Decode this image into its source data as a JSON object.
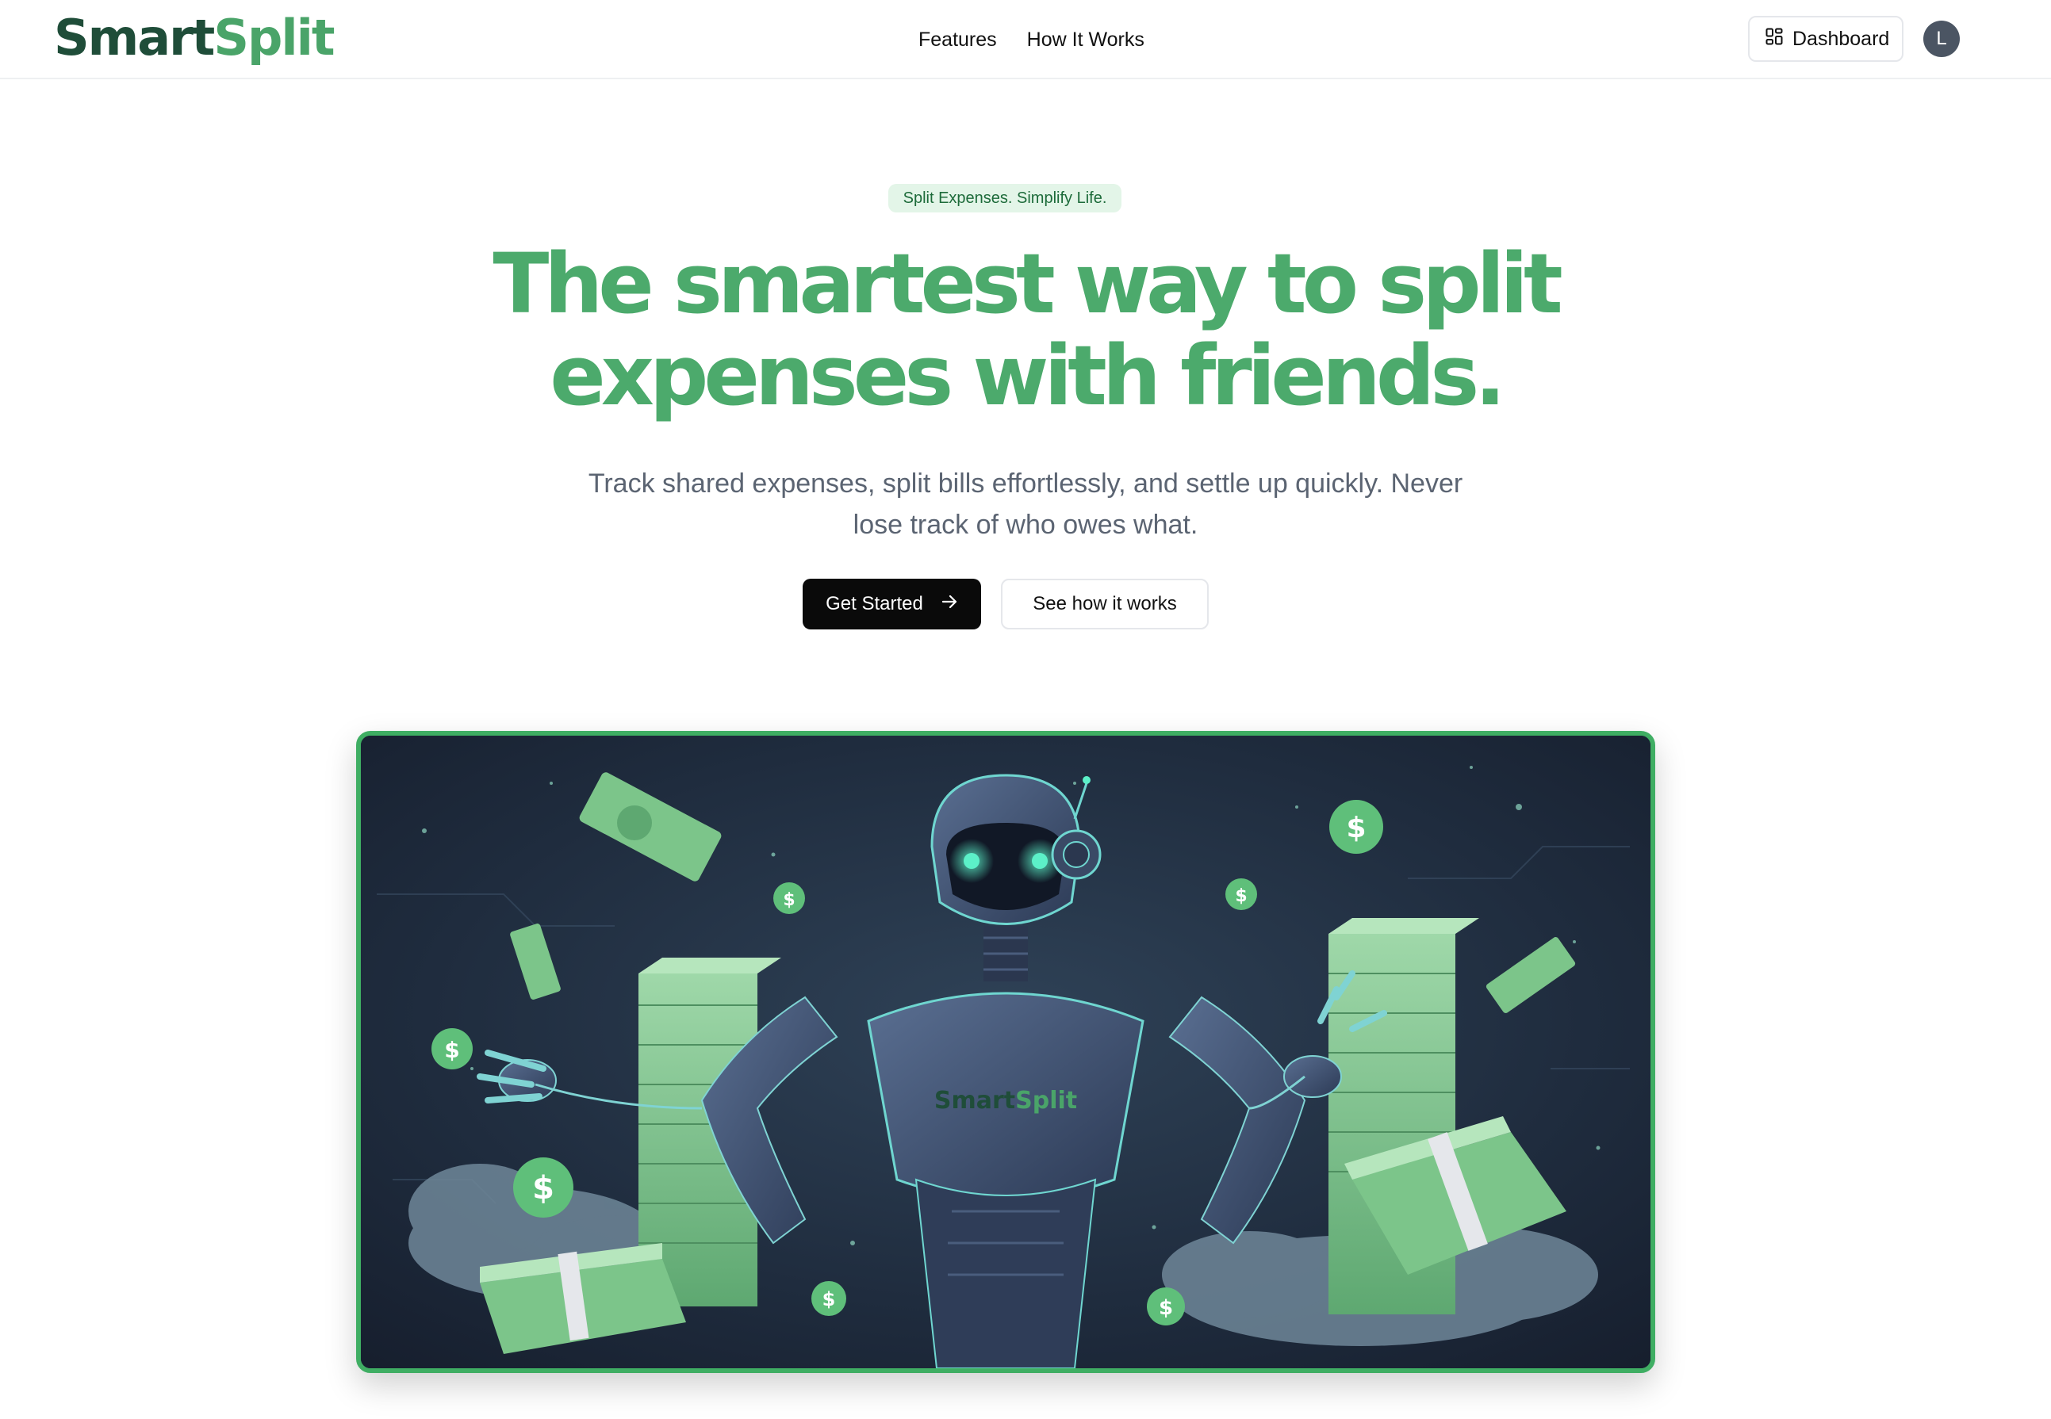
{
  "nav": {
    "logo_part1": "Smart",
    "logo_part2": "Split",
    "links": [
      "Features",
      "How It Works"
    ],
    "dashboard_label": "Dashboard",
    "avatar_initial": "L"
  },
  "hero": {
    "badge": "Split Expenses. Simplify Life.",
    "headline_line1": "The smartest way to split",
    "headline_line2": "expenses with friends.",
    "subtitle_line1": "Track shared expenses, split bills effortlessly, and settle up quickly. Never",
    "subtitle_line2": "lose track of who owes what.",
    "primary_cta": "Get Started",
    "secondary_cta": "See how it works"
  },
  "illustration": {
    "chest_text_part1": "Smart",
    "chest_text_part2": "Split",
    "coin_symbol": "$"
  },
  "colors": {
    "brand_dark": "#1f4d39",
    "brand_green": "#4aa469",
    "headline_green": "#4caa6c",
    "badge_bg": "#e3f5e8",
    "frame_border": "#3fae63",
    "primary_button": "#0a0a0a"
  },
  "icons": {
    "dashboard": "grid-icon",
    "cta_arrow": "arrow-right-icon"
  }
}
